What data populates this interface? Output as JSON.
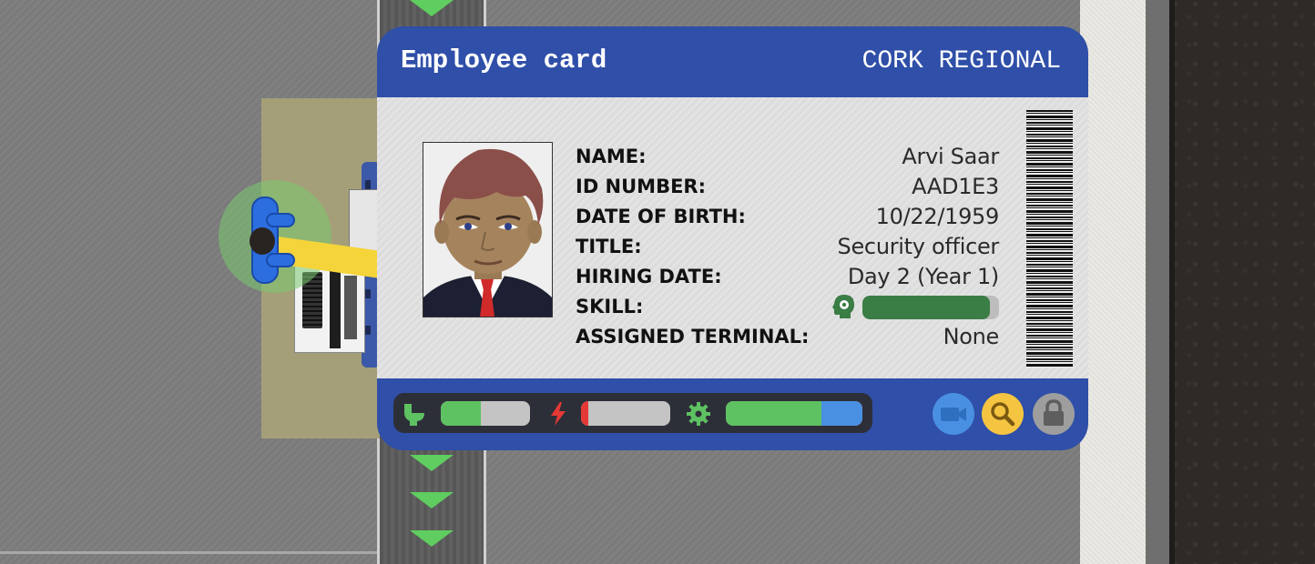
{
  "card": {
    "title": "Employee card",
    "organization": "CORK REGIONAL",
    "fields": [
      {
        "label": "NAME:",
        "value": "Arvi Saar"
      },
      {
        "label": "ID NUMBER:",
        "value": "AAD1E3"
      },
      {
        "label": "DATE OF BIRTH:",
        "value": "10/22/1959"
      },
      {
        "label": "TITLE:",
        "value": "Security officer"
      },
      {
        "label": "HIRING DATE:",
        "value": "Day 2 (Year 1)"
      },
      {
        "label": "SKILL:",
        "value": ""
      },
      {
        "label": "ASSIGNED TERMINAL:",
        "value": "None"
      }
    ],
    "skill_level": 0.93
  },
  "needs": {
    "toilet_level": 0.45,
    "energy_level": 0.08,
    "skill_progress": {
      "green": 0.7,
      "blue": 0.3
    }
  },
  "actions": [
    {
      "name": "camera",
      "icon": "video-camera-icon",
      "color": "#4a90e2"
    },
    {
      "name": "search",
      "icon": "magnifier-icon",
      "color": "#f5c542"
    },
    {
      "name": "lock",
      "icon": "padlock-icon",
      "color": "#9e9e9e"
    }
  ],
  "colors": {
    "card_blue": "#2f4fa8",
    "stat_green": "#5ec162",
    "stat_red": "#e53935",
    "stat_blue": "#4a90e2",
    "skill_dark_green": "#3a7d45"
  }
}
